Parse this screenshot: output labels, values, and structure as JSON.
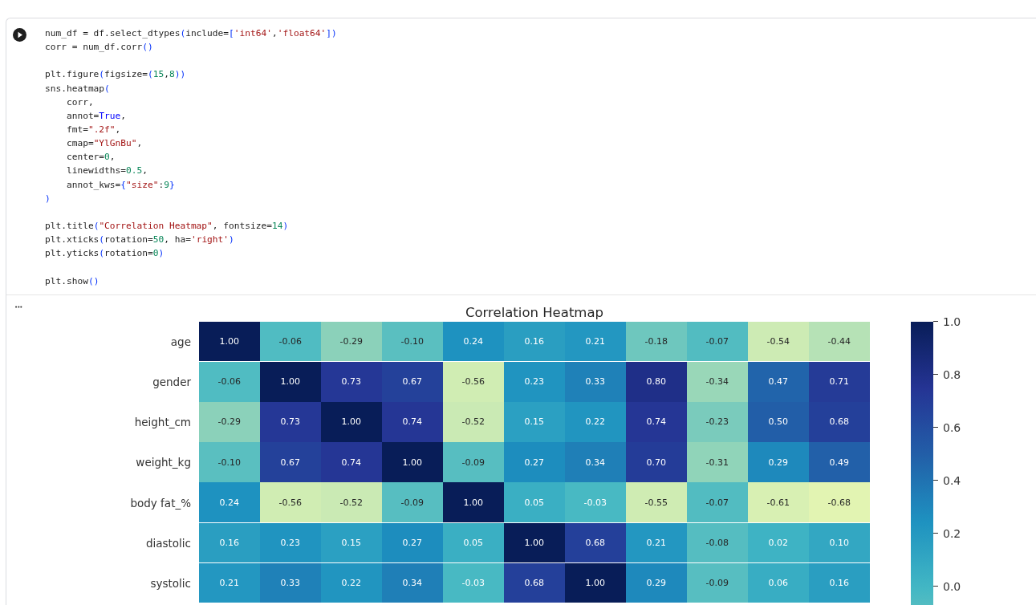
{
  "code_cell": {
    "blocks": [
      [
        [
          {
            "t": "num_df = df.select_dtypes",
            "kind": "p"
          },
          {
            "t": "(",
            "kind": "b"
          },
          {
            "t": "include=",
            "kind": "p"
          },
          {
            "t": "[",
            "kind": "b"
          },
          {
            "t": "'int64'",
            "kind": "s"
          },
          {
            "t": ",",
            "kind": "p"
          },
          {
            "t": "'float64'",
            "kind": "s"
          },
          {
            "t": "])",
            "kind": "b"
          }
        ],
        [
          {
            "t": "corr = num_df.corr",
            "kind": "p"
          },
          {
            "t": "()",
            "kind": "b"
          }
        ]
      ],
      [
        [
          {
            "t": "plt.figure",
            "kind": "p"
          },
          {
            "t": "(",
            "kind": "b"
          },
          {
            "t": "figsize=",
            "kind": "p"
          },
          {
            "t": "(",
            "kind": "b"
          },
          {
            "t": "15",
            "kind": "n"
          },
          {
            "t": ",",
            "kind": "p"
          },
          {
            "t": "8",
            "kind": "n"
          },
          {
            "t": "))",
            "kind": "b"
          }
        ],
        [
          {
            "t": "sns.heatmap",
            "kind": "p"
          },
          {
            "t": "(",
            "kind": "b"
          }
        ],
        [
          {
            "t": "    corr,",
            "kind": "p"
          }
        ],
        [
          {
            "t": "    annot=",
            "kind": "p"
          },
          {
            "t": "True",
            "kind": "k"
          },
          {
            "t": ",",
            "kind": "p"
          }
        ],
        [
          {
            "t": "    fmt=",
            "kind": "p"
          },
          {
            "t": "\".2f\"",
            "kind": "s"
          },
          {
            "t": ",",
            "kind": "p"
          }
        ],
        [
          {
            "t": "    cmap=",
            "kind": "p"
          },
          {
            "t": "\"YlGnBu\"",
            "kind": "s"
          },
          {
            "t": ",",
            "kind": "p"
          }
        ],
        [
          {
            "t": "    center=",
            "kind": "p"
          },
          {
            "t": "0",
            "kind": "n"
          },
          {
            "t": ",",
            "kind": "p"
          }
        ],
        [
          {
            "t": "    linewidths=",
            "kind": "p"
          },
          {
            "t": "0.5",
            "kind": "n"
          },
          {
            "t": ",",
            "kind": "p"
          }
        ],
        [
          {
            "t": "    annot_kws=",
            "kind": "p"
          },
          {
            "t": "{",
            "kind": "b"
          },
          {
            "t": "\"size\"",
            "kind": "s"
          },
          {
            "t": ":",
            "kind": "p"
          },
          {
            "t": "9",
            "kind": "n"
          },
          {
            "t": "}",
            "kind": "b"
          }
        ],
        [
          {
            "t": ")",
            "kind": "b"
          }
        ]
      ],
      [
        [
          {
            "t": "plt.title",
            "kind": "p"
          },
          {
            "t": "(",
            "kind": "b"
          },
          {
            "t": "\"Correlation Heatmap\"",
            "kind": "s"
          },
          {
            "t": ", fontsize=",
            "kind": "p"
          },
          {
            "t": "14",
            "kind": "n"
          },
          {
            "t": ")",
            "kind": "b"
          }
        ],
        [
          {
            "t": "plt.xticks",
            "kind": "p"
          },
          {
            "t": "(",
            "kind": "b"
          },
          {
            "t": "rotation=",
            "kind": "p"
          },
          {
            "t": "50",
            "kind": "n"
          },
          {
            "t": ", ha=",
            "kind": "p"
          },
          {
            "t": "'right'",
            "kind": "s"
          },
          {
            "t": ")",
            "kind": "b"
          }
        ],
        [
          {
            "t": "plt.yticks",
            "kind": "p"
          },
          {
            "t": "(",
            "kind": "b"
          },
          {
            "t": "rotation=",
            "kind": "p"
          },
          {
            "t": "0",
            "kind": "n"
          },
          {
            "t": ")",
            "kind": "b"
          }
        ]
      ],
      [
        [
          {
            "t": "plt.show",
            "kind": "p"
          },
          {
            "t": "()",
            "kind": "b"
          }
        ]
      ]
    ]
  },
  "output": {
    "menu_glyph": "•••",
    "heatmap": {
      "title": "Correlation Heatmap",
      "rows": [
        {
          "label": "age",
          "values": [
            "1.00",
            "-0.06",
            "-0.29",
            "-0.10",
            "0.24",
            "0.16",
            "0.21",
            "-0.18",
            "-0.07",
            "-0.54",
            "-0.44"
          ]
        },
        {
          "label": "gender",
          "values": [
            "-0.06",
            "1.00",
            "0.73",
            "0.67",
            "-0.56",
            "0.23",
            "0.33",
            "0.80",
            "-0.34",
            "0.47",
            "0.71"
          ]
        },
        {
          "label": "height_cm",
          "values": [
            "-0.29",
            "0.73",
            "1.00",
            "0.74",
            "-0.52",
            "0.15",
            "0.22",
            "0.74",
            "-0.23",
            "0.50",
            "0.68"
          ]
        },
        {
          "label": "weight_kg",
          "values": [
            "-0.10",
            "0.67",
            "0.74",
            "1.00",
            "-0.09",
            "0.27",
            "0.34",
            "0.70",
            "-0.31",
            "0.29",
            "0.49"
          ]
        },
        {
          "label": "body fat_%",
          "values": [
            "0.24",
            "-0.56",
            "-0.52",
            "-0.09",
            "1.00",
            "0.05",
            "-0.03",
            "-0.55",
            "-0.07",
            "-0.61",
            "-0.68"
          ]
        },
        {
          "label": "diastolic",
          "values": [
            "0.16",
            "0.23",
            "0.15",
            "0.27",
            "0.05",
            "1.00",
            "0.68",
            "0.21",
            "-0.08",
            "0.02",
            "0.10"
          ]
        },
        {
          "label": "systolic",
          "values": [
            "0.21",
            "0.33",
            "0.22",
            "0.34",
            "-0.03",
            "0.68",
            "1.00",
            "0.29",
            "-0.09",
            "0.06",
            "0.16"
          ]
        }
      ],
      "colorbar_ticks": [
        {
          "label": "1.0"
        },
        {
          "label": "0.8"
        },
        {
          "label": "0.6"
        },
        {
          "label": "0.4"
        },
        {
          "label": "0.2"
        },
        {
          "label": "0.0"
        }
      ]
    }
  }
}
